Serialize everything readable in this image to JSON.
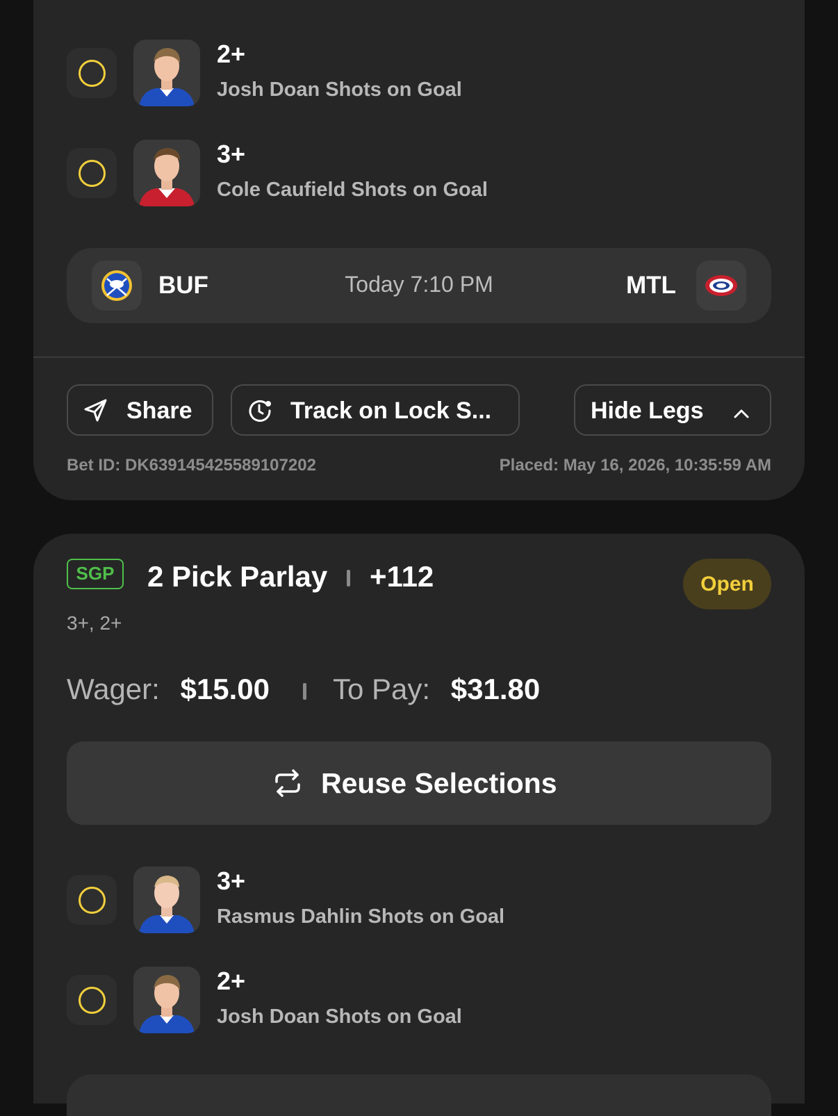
{
  "card1": {
    "legs": [
      {
        "line": "2+",
        "market": "Josh Doan Shots on Goal",
        "jersey_color": "#1f4fbf"
      },
      {
        "line": "3+",
        "market": "Cole Caufield Shots on Goal",
        "jersey_color": "#c8202e"
      }
    ],
    "matchup": {
      "home_team": "BUF",
      "away_team": "MTL",
      "time": "Today 7:10 PM"
    },
    "actions": {
      "share_label": "Share",
      "track_label": "Track on Lock S...",
      "hide_legs_label": "Hide Legs"
    },
    "bet_id": "Bet ID: DK639145425589107202",
    "placed": "Placed: May 16, 2026, 10:35:59 AM"
  },
  "card2": {
    "badge": "SGP",
    "title": "2 Pick Parlay",
    "odds": "+112",
    "status": "Open",
    "sub_lines": "3+, 2+",
    "wager_label": "Wager:",
    "wager_value": "$15.00",
    "to_pay_label": "To Pay:",
    "to_pay_value": "$31.80",
    "reuse_label": "Reuse Selections",
    "legs": [
      {
        "line": "3+",
        "market": "Rasmus Dahlin Shots on Goal",
        "jersey_color": "#1f4fbf"
      },
      {
        "line": "2+",
        "market": "Josh Doan Shots on Goal",
        "jersey_color": "#1f4fbf"
      }
    ]
  },
  "colors": {
    "background": "#121212",
    "card": "#262626",
    "pending_ring": "#f2cf3c",
    "sgp_green": "#4fbf4a",
    "open_pill_bg": "#4a3f1c"
  },
  "icons": {
    "status": "pending-circle-icon",
    "share": "send-icon",
    "track": "timer-icon",
    "hide": "chevron-up-icon",
    "reuse": "repeat-icon"
  }
}
